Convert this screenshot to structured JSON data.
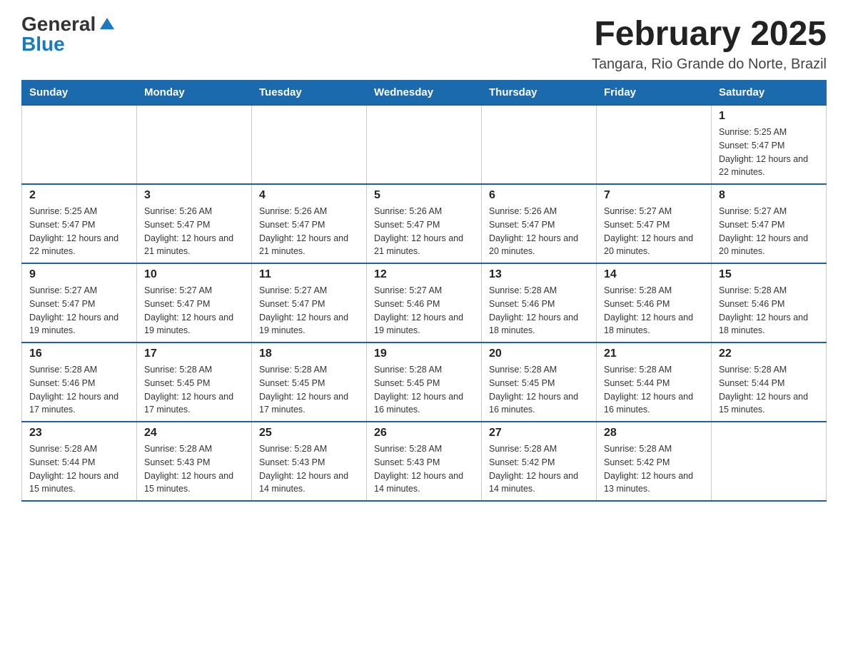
{
  "logo": {
    "general": "General",
    "blue": "Blue"
  },
  "header": {
    "title": "February 2025",
    "subtitle": "Tangara, Rio Grande do Norte, Brazil"
  },
  "days_of_week": [
    "Sunday",
    "Monday",
    "Tuesday",
    "Wednesday",
    "Thursday",
    "Friday",
    "Saturday"
  ],
  "weeks": [
    [
      {
        "day": "",
        "sunrise": "",
        "sunset": "",
        "daylight": ""
      },
      {
        "day": "",
        "sunrise": "",
        "sunset": "",
        "daylight": ""
      },
      {
        "day": "",
        "sunrise": "",
        "sunset": "",
        "daylight": ""
      },
      {
        "day": "",
        "sunrise": "",
        "sunset": "",
        "daylight": ""
      },
      {
        "day": "",
        "sunrise": "",
        "sunset": "",
        "daylight": ""
      },
      {
        "day": "",
        "sunrise": "",
        "sunset": "",
        "daylight": ""
      },
      {
        "day": "1",
        "sunrise": "Sunrise: 5:25 AM",
        "sunset": "Sunset: 5:47 PM",
        "daylight": "Daylight: 12 hours and 22 minutes."
      }
    ],
    [
      {
        "day": "2",
        "sunrise": "Sunrise: 5:25 AM",
        "sunset": "Sunset: 5:47 PM",
        "daylight": "Daylight: 12 hours and 22 minutes."
      },
      {
        "day": "3",
        "sunrise": "Sunrise: 5:26 AM",
        "sunset": "Sunset: 5:47 PM",
        "daylight": "Daylight: 12 hours and 21 minutes."
      },
      {
        "day": "4",
        "sunrise": "Sunrise: 5:26 AM",
        "sunset": "Sunset: 5:47 PM",
        "daylight": "Daylight: 12 hours and 21 minutes."
      },
      {
        "day": "5",
        "sunrise": "Sunrise: 5:26 AM",
        "sunset": "Sunset: 5:47 PM",
        "daylight": "Daylight: 12 hours and 21 minutes."
      },
      {
        "day": "6",
        "sunrise": "Sunrise: 5:26 AM",
        "sunset": "Sunset: 5:47 PM",
        "daylight": "Daylight: 12 hours and 20 minutes."
      },
      {
        "day": "7",
        "sunrise": "Sunrise: 5:27 AM",
        "sunset": "Sunset: 5:47 PM",
        "daylight": "Daylight: 12 hours and 20 minutes."
      },
      {
        "day": "8",
        "sunrise": "Sunrise: 5:27 AM",
        "sunset": "Sunset: 5:47 PM",
        "daylight": "Daylight: 12 hours and 20 minutes."
      }
    ],
    [
      {
        "day": "9",
        "sunrise": "Sunrise: 5:27 AM",
        "sunset": "Sunset: 5:47 PM",
        "daylight": "Daylight: 12 hours and 19 minutes."
      },
      {
        "day": "10",
        "sunrise": "Sunrise: 5:27 AM",
        "sunset": "Sunset: 5:47 PM",
        "daylight": "Daylight: 12 hours and 19 minutes."
      },
      {
        "day": "11",
        "sunrise": "Sunrise: 5:27 AM",
        "sunset": "Sunset: 5:47 PM",
        "daylight": "Daylight: 12 hours and 19 minutes."
      },
      {
        "day": "12",
        "sunrise": "Sunrise: 5:27 AM",
        "sunset": "Sunset: 5:46 PM",
        "daylight": "Daylight: 12 hours and 19 minutes."
      },
      {
        "day": "13",
        "sunrise": "Sunrise: 5:28 AM",
        "sunset": "Sunset: 5:46 PM",
        "daylight": "Daylight: 12 hours and 18 minutes."
      },
      {
        "day": "14",
        "sunrise": "Sunrise: 5:28 AM",
        "sunset": "Sunset: 5:46 PM",
        "daylight": "Daylight: 12 hours and 18 minutes."
      },
      {
        "day": "15",
        "sunrise": "Sunrise: 5:28 AM",
        "sunset": "Sunset: 5:46 PM",
        "daylight": "Daylight: 12 hours and 18 minutes."
      }
    ],
    [
      {
        "day": "16",
        "sunrise": "Sunrise: 5:28 AM",
        "sunset": "Sunset: 5:46 PM",
        "daylight": "Daylight: 12 hours and 17 minutes."
      },
      {
        "day": "17",
        "sunrise": "Sunrise: 5:28 AM",
        "sunset": "Sunset: 5:45 PM",
        "daylight": "Daylight: 12 hours and 17 minutes."
      },
      {
        "day": "18",
        "sunrise": "Sunrise: 5:28 AM",
        "sunset": "Sunset: 5:45 PM",
        "daylight": "Daylight: 12 hours and 17 minutes."
      },
      {
        "day": "19",
        "sunrise": "Sunrise: 5:28 AM",
        "sunset": "Sunset: 5:45 PM",
        "daylight": "Daylight: 12 hours and 16 minutes."
      },
      {
        "day": "20",
        "sunrise": "Sunrise: 5:28 AM",
        "sunset": "Sunset: 5:45 PM",
        "daylight": "Daylight: 12 hours and 16 minutes."
      },
      {
        "day": "21",
        "sunrise": "Sunrise: 5:28 AM",
        "sunset": "Sunset: 5:44 PM",
        "daylight": "Daylight: 12 hours and 16 minutes."
      },
      {
        "day": "22",
        "sunrise": "Sunrise: 5:28 AM",
        "sunset": "Sunset: 5:44 PM",
        "daylight": "Daylight: 12 hours and 15 minutes."
      }
    ],
    [
      {
        "day": "23",
        "sunrise": "Sunrise: 5:28 AM",
        "sunset": "Sunset: 5:44 PM",
        "daylight": "Daylight: 12 hours and 15 minutes."
      },
      {
        "day": "24",
        "sunrise": "Sunrise: 5:28 AM",
        "sunset": "Sunset: 5:43 PM",
        "daylight": "Daylight: 12 hours and 15 minutes."
      },
      {
        "day": "25",
        "sunrise": "Sunrise: 5:28 AM",
        "sunset": "Sunset: 5:43 PM",
        "daylight": "Daylight: 12 hours and 14 minutes."
      },
      {
        "day": "26",
        "sunrise": "Sunrise: 5:28 AM",
        "sunset": "Sunset: 5:43 PM",
        "daylight": "Daylight: 12 hours and 14 minutes."
      },
      {
        "day": "27",
        "sunrise": "Sunrise: 5:28 AM",
        "sunset": "Sunset: 5:42 PM",
        "daylight": "Daylight: 12 hours and 14 minutes."
      },
      {
        "day": "28",
        "sunrise": "Sunrise: 5:28 AM",
        "sunset": "Sunset: 5:42 PM",
        "daylight": "Daylight: 12 hours and 13 minutes."
      },
      {
        "day": "",
        "sunrise": "",
        "sunset": "",
        "daylight": ""
      }
    ]
  ]
}
